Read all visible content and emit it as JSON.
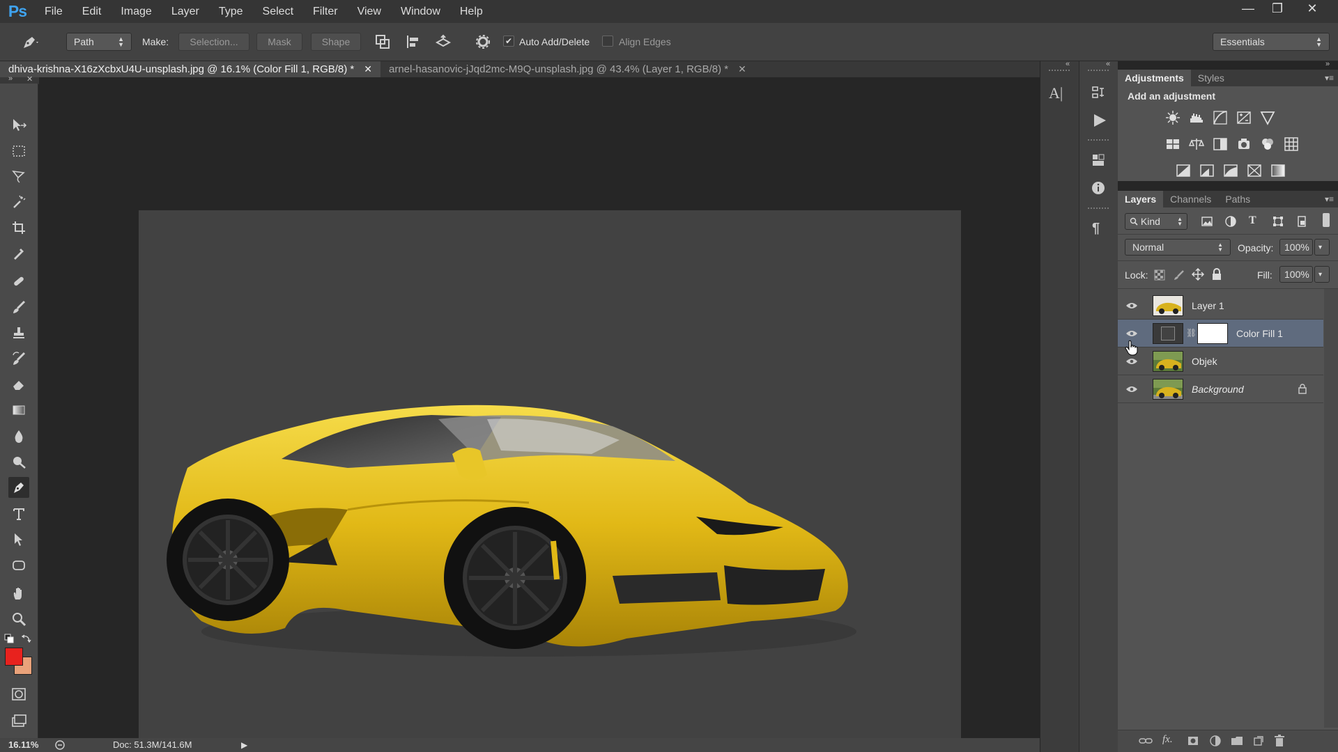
{
  "app": {
    "logo": "Ps"
  },
  "menu": [
    "File",
    "Edit",
    "Image",
    "Layer",
    "Type",
    "Select",
    "Filter",
    "View",
    "Window",
    "Help"
  ],
  "window_controls": {
    "minimize": "—",
    "restore": "❐",
    "close": "✕"
  },
  "options": {
    "tool_icon": "pen-tool-icon",
    "mode": "Path",
    "make_label": "Make:",
    "selection_btn": "Selection...",
    "mask_btn": "Mask",
    "shape_btn": "Shape",
    "auto_add_delete": {
      "label": "Auto Add/Delete",
      "checked": true
    },
    "align_edges": {
      "label": "Align Edges",
      "checked": false
    },
    "workspace": "Essentials"
  },
  "tabs": [
    {
      "label": "dhiva-krishna-X16zXcbxU4U-unsplash.jpg @ 16.1% (Color Fill 1, RGB/8) *",
      "active": true
    },
    {
      "label": "arnel-hasanovic-jJqd2mc-M9Q-unsplash.jpg @ 43.4% (Layer 1, RGB/8) *",
      "active": false
    }
  ],
  "status": {
    "zoom": "16.11%",
    "doc": "Doc: 51.3M/141.6M"
  },
  "colors": {
    "foreground": "#e8221e",
    "background": "#e9a27a",
    "canvas": "#424242",
    "car": "#e3be16"
  },
  "adjustments": {
    "tabs": [
      "Adjustments",
      "Styles"
    ],
    "title": "Add an adjustment"
  },
  "layers_panel": {
    "tabs": [
      "Layers",
      "Channels",
      "Paths"
    ],
    "filter": "Kind",
    "blend_mode": "Normal",
    "opacity_label": "Opacity:",
    "opacity": "100%",
    "lock_label": "Lock:",
    "fill_label": "Fill:",
    "fill": "100%",
    "layers": [
      {
        "name": "Layer 1",
        "visible": true,
        "selected": false
      },
      {
        "name": "Color Fill 1",
        "visible": true,
        "selected": true
      },
      {
        "name": "Objek",
        "visible": true,
        "selected": false
      },
      {
        "name": "Background",
        "visible": true,
        "selected": false,
        "locked": true
      }
    ]
  }
}
